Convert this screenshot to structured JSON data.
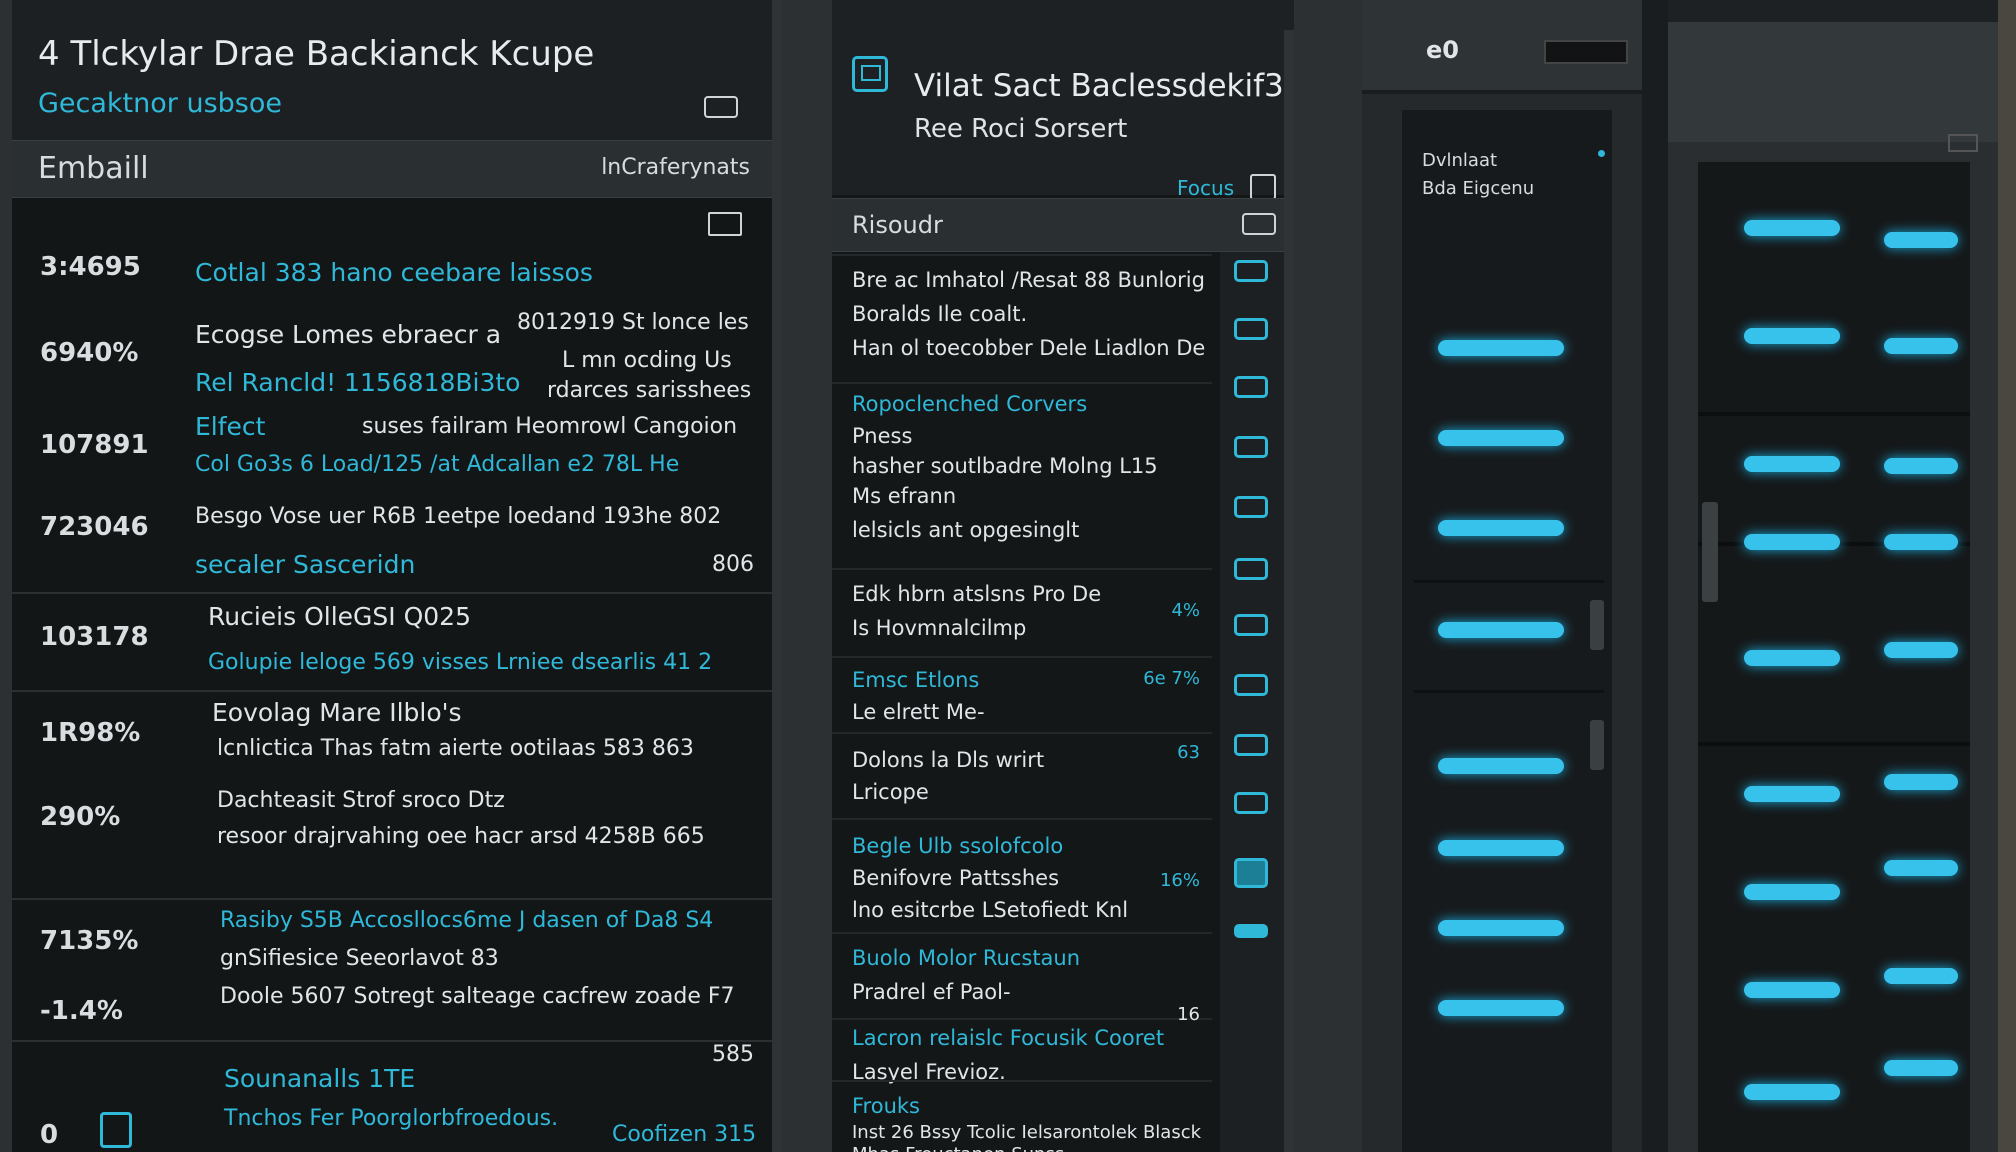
{
  "accent_color": "#2fb8d8",
  "screen1": {
    "title": "4 Tlckylar Drae Backianck Kcupe",
    "subtitle": "Gecaktnor usbsoe",
    "bar_label": "Embaill",
    "bar_right": "lnCraferynats",
    "rows": [
      {
        "pct": "3:4695",
        "lines": [
          {
            "text": "Cotlal 383 hano ceebare laissos",
            "accent": true
          }
        ]
      },
      {
        "pct": "6940%",
        "lines": [
          {
            "text": "Ecogse Lomes ebraecr a",
            "accent": false
          },
          {
            "text": "8012919 St lonce les",
            "accent": false
          }
        ]
      },
      {
        "pct": "",
        "lines": [
          {
            "text": "Rel Rancld! 1156818Bi3to",
            "accent": true
          },
          {
            "text": "L mn ocding Us",
            "accent": false
          },
          {
            "text": "rdarces sarisshees",
            "accent": false
          }
        ]
      },
      {
        "pct": "107891",
        "lines": [
          {
            "text": "Elfect",
            "accent": true
          },
          {
            "text": "suses failram Heomrowl Cangoion",
            "accent": false
          }
        ]
      },
      {
        "pct": "",
        "lines": [
          {
            "text": "Col Go3s 6 Load/125 /at Adcallan e2 78L He",
            "accent": true
          }
        ]
      },
      {
        "pct": "723046",
        "lines": [
          {
            "text": "Besgo Vose uer R6B 1eetpe loedand 193he 802",
            "accent": false
          }
        ]
      },
      {
        "pct": "",
        "lines": [
          {
            "text": "secaler Sasceridn",
            "accent": true
          },
          {
            "text": "806",
            "accent": false
          }
        ]
      },
      {
        "pct": "103178",
        "lines": [
          {
            "text": "Rucieis OlleGSI Q025",
            "accent": false
          }
        ]
      },
      {
        "pct": "",
        "lines": [
          {
            "text": "Golupie leloge 569 visses Lrniee dsearlis 41 2",
            "accent": true
          }
        ]
      },
      {
        "pct": "1R98%",
        "lines": [
          {
            "text": "Eovolag Mare Ilblo's",
            "accent": false
          },
          {
            "text": "lcnlictica Thas fatm aierte ootilaas 583 863",
            "accent": false
          }
        ]
      },
      {
        "pct": "290%",
        "lines": [
          {
            "text": "Dachteasit Strof sroco Dtz",
            "accent": false
          },
          {
            "text": "resoor drajrvahing oee hacr arsd 4258B 665",
            "accent": false
          }
        ]
      },
      {
        "pct": "7135%",
        "lines": [
          {
            "text": "Rasiby S5B Accosllocs6me J dasen of Da8 S4",
            "accent": true
          },
          {
            "text": "gnSifiesice Seeorlavot 83",
            "accent": false
          }
        ]
      },
      {
        "pct": "-1.4%",
        "lines": [
          {
            "text": "Doole 5607 Sotregt salteage cacfrew zoade F7",
            "accent": false
          }
        ]
      },
      {
        "pct": "0",
        "lines": [
          {
            "text": "Sounanalls 1TE",
            "accent": true
          },
          {
            "text": "Tnchos Fer Poorglorbfroedous.",
            "accent": true
          },
          {
            "text": "Coofizen 315",
            "accent": true
          },
          {
            "text": "585",
            "accent": false
          }
        ]
      }
    ]
  },
  "screen2": {
    "title": "Vilat Sact Baclessdekif3",
    "subtitle": "Ree Roci Sorsert",
    "link": "Focus",
    "bar_label": "Risoudr",
    "rows": [
      {
        "lines": [
          {
            "text": "Bre ac Imhatol /Resat 88 Bunlorig",
            "accent": false
          },
          {
            "text": "Boralds Ile coalt.",
            "accent": false
          },
          {
            "text": "Han ol toecobber Dele Liadlon De",
            "accent": false
          }
        ],
        "num": "",
        "num_accent": false
      },
      {
        "lines": [
          {
            "text": "Ropoclenched Corvers",
            "accent": true
          },
          {
            "text": "Pness",
            "accent": false
          },
          {
            "text": "hasher soutlbadre Molng L15",
            "accent": false
          },
          {
            "text": "Ms efrann",
            "accent": false
          },
          {
            "text": "lelsicls ant opgesinglt",
            "accent": false
          }
        ],
        "num": "",
        "num_accent": false
      },
      {
        "lines": [
          {
            "text": "Edk hbrn atslsns Pro De",
            "accent": false
          },
          {
            "text": "Is Hovmnalcilmp",
            "accent": false
          }
        ],
        "num": "4%",
        "num_accent": true
      },
      {
        "lines": [
          {
            "text": "Emsc Etlons",
            "accent": true
          },
          {
            "text": "Le elrett Me-",
            "accent": false
          }
        ],
        "num": "6e 7%",
        "num_accent": true
      },
      {
        "lines": [
          {
            "text": "Dolons la Dls wrirt",
            "accent": false
          },
          {
            "text": "Lricope",
            "accent": false
          }
        ],
        "num": "63",
        "num_accent": true
      },
      {
        "lines": [
          {
            "text": "Begle Ulb ssolofcolo",
            "accent": true
          },
          {
            "text": "Benifovre Pattsshes",
            "accent": false
          },
          {
            "text": "lno esitcrbe LSetofiedt Knl",
            "accent": false
          }
        ],
        "num": "16%",
        "num_accent": true
      },
      {
        "lines": [
          {
            "text": "Buolo Molor Rucstaun",
            "accent": true
          },
          {
            "text": "Pradrel ef Paol-",
            "accent": false
          }
        ],
        "num": "",
        "num_accent": false
      },
      {
        "lines": [
          {
            "text": "Lacron relaislc Focusik Cooret",
            "accent": true
          },
          {
            "text": "Lasyel Frevioz.",
            "accent": false
          }
        ],
        "num": "16",
        "num_accent": false
      },
      {
        "lines": [
          {
            "text": "Frouks",
            "accent": true
          },
          {
            "text": "Inst 26 Bssy Tcolic Ielsarontolek Blasck",
            "accent": false
          },
          {
            "text": "Mhas Freuctanen Sunss",
            "accent": false
          }
        ],
        "num": "",
        "num_accent": false
      }
    ],
    "rail_icons": [
      "panel-icon",
      "panel-icon",
      "panel-icon",
      "panel-icon",
      "panel-icon",
      "panel-icon",
      "panel-icon",
      "panel-icon",
      "panel-icon",
      "panel-icon",
      "panel-icon",
      "panel-icon"
    ]
  },
  "rack3": {
    "label": "e0",
    "panel_line1": "Dvlnlaat",
    "panel_line2": "Bda Eigcenu"
  }
}
